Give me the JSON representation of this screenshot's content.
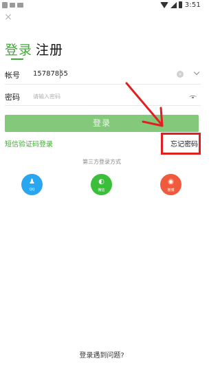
{
  "status_bar": {
    "time": "3:51"
  },
  "header": {
    "close_glyph": "×"
  },
  "tabs": [
    {
      "label": "登录"
    },
    {
      "label": "注册"
    }
  ],
  "form": {
    "account_label": "帐号",
    "account_value": "15787855",
    "clear_glyph": "×",
    "password_label": "密码",
    "password_placeholder": "请输入密码",
    "login_button": "登录"
  },
  "links": {
    "sms_login": "短信验证码登录",
    "forgot_password": "忘记密码"
  },
  "third_party": {
    "title": "第三方登录方式",
    "providers": [
      {
        "name": "QQ",
        "glyph": "♟",
        "color": "#28a7f0"
      },
      {
        "name": "微信",
        "glyph": "◐",
        "color": "#3bbf3b"
      },
      {
        "name": "微博",
        "glyph": "◉",
        "color": "#f15a3c"
      }
    ]
  },
  "footer": {
    "trouble_link": "登录遇到问题?"
  },
  "colors": {
    "accent": "#3fa934",
    "button": "#84c87c",
    "annotation": "#e02020"
  }
}
